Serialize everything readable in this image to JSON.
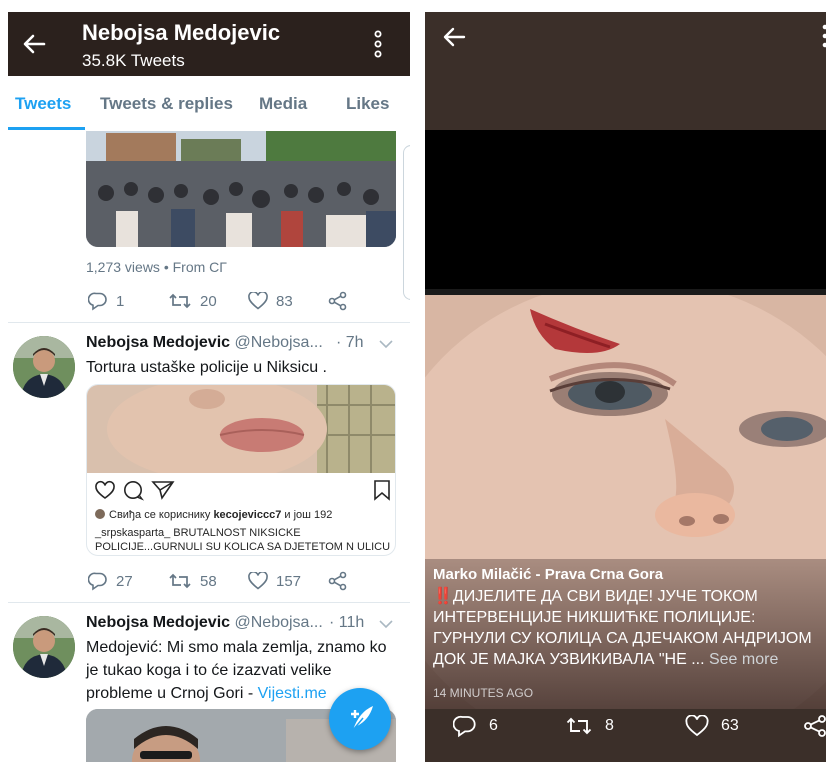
{
  "left": {
    "header": {
      "title": "Nebojsa Medojevic",
      "subtitle": "35.8K Tweets"
    },
    "tabs": [
      "Tweets",
      "Tweets & replies",
      "Media",
      "Likes"
    ],
    "active_tab": "Tweets",
    "tweet0": {
      "meta": "1,273 views • From СГ",
      "replies": "1",
      "retweets": "20",
      "likes": "83"
    },
    "tweet1": {
      "name": "Nebojsa Medojevic",
      "handle": "@Nebojsa...",
      "time": "· 7h",
      "text": "Tortura ustaške policije u Niksicu .",
      "insta": {
        "liked_prefix": "Свиђа се кориснику ",
        "liked_user": "kecojeviccc7",
        "liked_suffix": " и још 192",
        "caption_line1": "_srpskasparta_ BRUTALNOST NIKSICKE",
        "caption_line2": "POLICIJE...GURNULI SU KOLICA SA DJETETOM N  ULICU"
      },
      "replies": "27",
      "retweets": "58",
      "likes": "157"
    },
    "tweet2": {
      "name": "Nebojsa Medojevic",
      "handle": "@Nebojsa...",
      "time": "· 11h",
      "text": "Medojević: Mi smo mala zemlja, znamo ko je tukao koga i to će izazvati velike probleme u Crnoj Gori - ",
      "link": "Vijesti.me"
    },
    "colors": {
      "accent": "#1da1f2",
      "header_bg": "#2b211d",
      "muted": "#657786"
    },
    "icons": [
      "back-arrow-icon",
      "more-vertical-icon",
      "reply-icon",
      "retweet-icon",
      "like-icon",
      "share-icon",
      "compose-icon"
    ]
  },
  "right": {
    "author": "Marko Milačić - Prava Crna Gora",
    "text_line1": "‼️ДИЈЕЛИТЕ ДА СВИ ВИДЕ! ЈУЧЕ ТОКОМ",
    "text_line2": "ИНТЕРВЕНЦИЈЕ НИКШИЋКЕ ПОЛИЦИЈЕ:",
    "text_line3": "ГУРНУЛИ СУ КОЛИЦА СА ДЈЕЧАКОМ АНДРИЈОМ",
    "text_line4": "ДОК ЈЕ МАЈКА УЗВИКИВАЛА \"НЕ ... ",
    "see_more": "See more",
    "time": "14 MINUTES AGO",
    "replies": "6",
    "retweets": "8",
    "likes": "63",
    "colors": {
      "bar_bg": "#3b2f29"
    }
  }
}
